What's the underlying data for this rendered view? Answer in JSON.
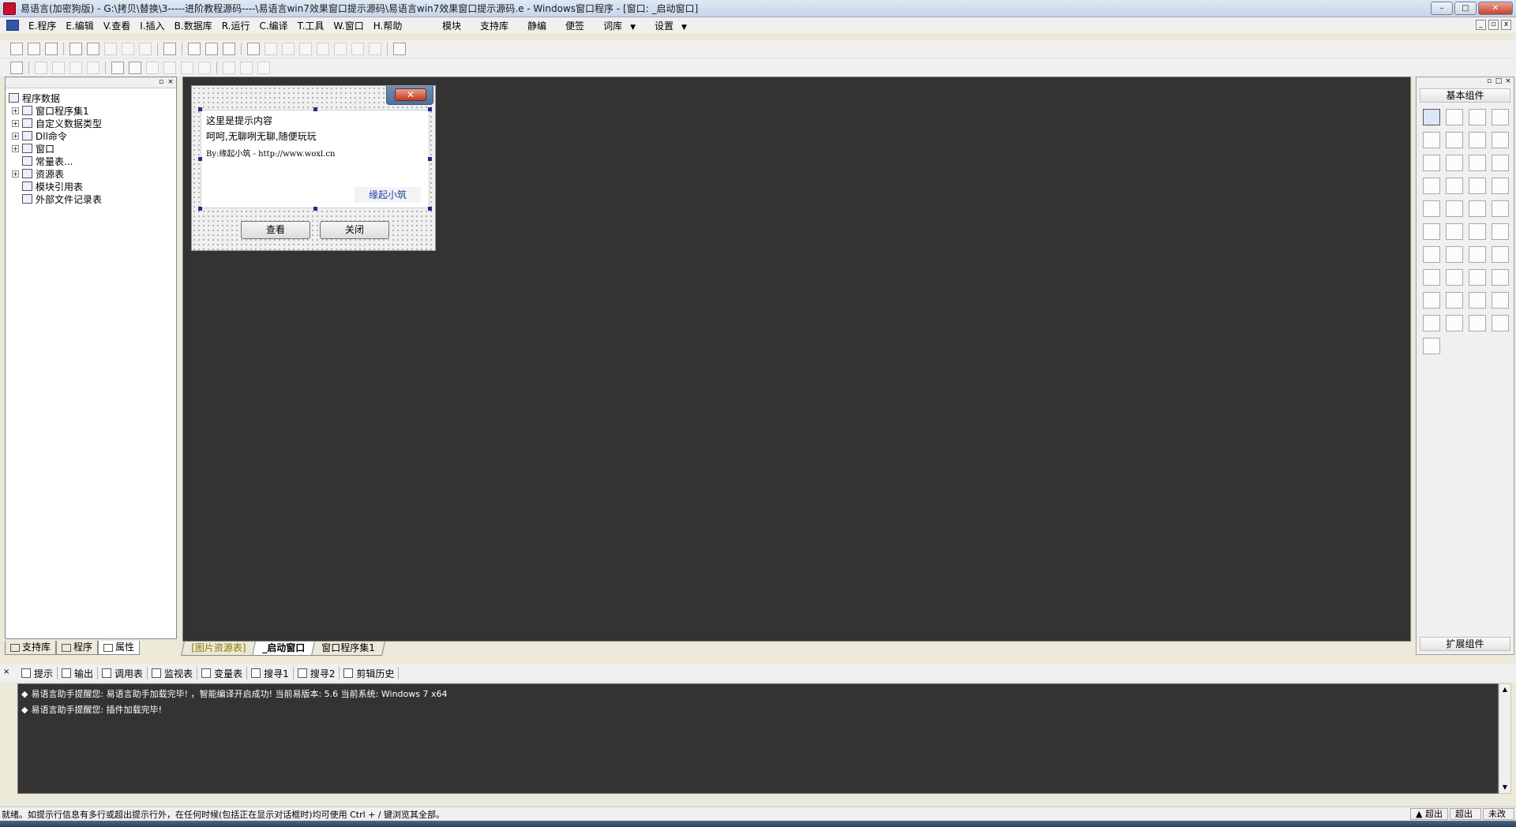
{
  "window": {
    "title": "易语言(加密狗版) - G:\\拷贝\\替换\\3-----进阶教程源码----\\易语言win7效果窗口提示源码\\易语言win7效果窗口提示源码.e - Windows窗口程序 - [窗口: _启动窗口]",
    "buttons": {
      "minimize": "–",
      "maximize": "□",
      "close": "✕"
    }
  },
  "menubar": {
    "items": [
      "E.程序",
      "E.编辑",
      "V.查看",
      "I.插入",
      "B.数据库",
      "R.运行",
      "C.编译",
      "T.工具",
      "W.窗口",
      "H.帮助"
    ],
    "right_items": [
      "模块",
      "支持库",
      "静编",
      "便签"
    ],
    "ciku": "词库",
    "settings": "设置",
    "dd_arrow": "▼",
    "mdi_buttons": [
      "_",
      "▫",
      "x"
    ]
  },
  "left_panel": {
    "tree": [
      {
        "label": "程序数据",
        "expander": "",
        "icon": "db"
      },
      {
        "label": "窗口程序集1",
        "expander": "+",
        "icon": "cls"
      },
      {
        "label": "自定义数据类型",
        "expander": "+",
        "icon": "typ"
      },
      {
        "label": "Dll命令",
        "expander": "+",
        "icon": "dll"
      },
      {
        "label": "窗口",
        "expander": "+",
        "icon": "win"
      },
      {
        "label": "常量表...",
        "expander": "",
        "icon": "con"
      },
      {
        "label": "资源表",
        "expander": "+",
        "icon": "res"
      },
      {
        "label": "模块引用表",
        "expander": "",
        "icon": "mod"
      },
      {
        "label": "外部文件记录表",
        "expander": "",
        "icon": "ext"
      }
    ],
    "tabs": [
      "支持库",
      "程序",
      "属性"
    ]
  },
  "form": {
    "close_glyph": "✕",
    "panel_lines": [
      "这里是提示内容",
      "呵呵,无聊咧无聊,随便玩玩",
      "By:缘起小筑 - http://www.woxl.cn"
    ],
    "link_label": "缘起小筑",
    "buttons": [
      "查看",
      "关闭"
    ]
  },
  "doc_tabs": [
    "[图片资源表]",
    "_启动窗口",
    "窗口程序集1"
  ],
  "right_panel": {
    "title": "基本组件",
    "footer": "扩展组件",
    "components": [
      "arrow-pointer",
      "label",
      "picture",
      "shape",
      "edit",
      "frame",
      "font",
      "line",
      "checkbox",
      "radio",
      "listbox",
      "grid",
      "table",
      "slider",
      "scrollbar",
      "splitter",
      "ruler",
      "splitter-v",
      "panel",
      "tab",
      "tree",
      "listview",
      "combo",
      "calendar",
      "toolbar",
      "picker",
      "datagrid",
      "keyboard",
      "timer",
      "printer",
      "net-client",
      "net-server",
      "udp",
      "transfer",
      "frame-box",
      "db-grid",
      "query",
      "db",
      "chart",
      "odbc",
      "odbc-db"
    ]
  },
  "output_tabs": [
    "提示",
    "输出",
    "调用表",
    "监视表",
    "变量表",
    "搜寻1",
    "搜寻2",
    "剪辑历史"
  ],
  "output_lines": [
    "易语言助手提醒您: 易语言助手加载完毕!  ，智能编译开启成功!  当前易版本: 5.6  当前系统: Windows 7 x64",
    "易语言助手提醒您: 插件加载完毕!"
  ],
  "output_bullet": "◆",
  "status": {
    "text": "就绪。如提示行信息有多行或超出提示行外，在任何时候(包括正在显示对话框时)均可使用 Ctrl + / 键浏览其全部。",
    "cells": [
      "超出",
      "超出",
      "未改"
    ],
    "cell_arrow": "▲"
  },
  "colors": {
    "design_bg": "#333333",
    "accent_close": "#c23a22",
    "link": "#1e3ea8"
  }
}
